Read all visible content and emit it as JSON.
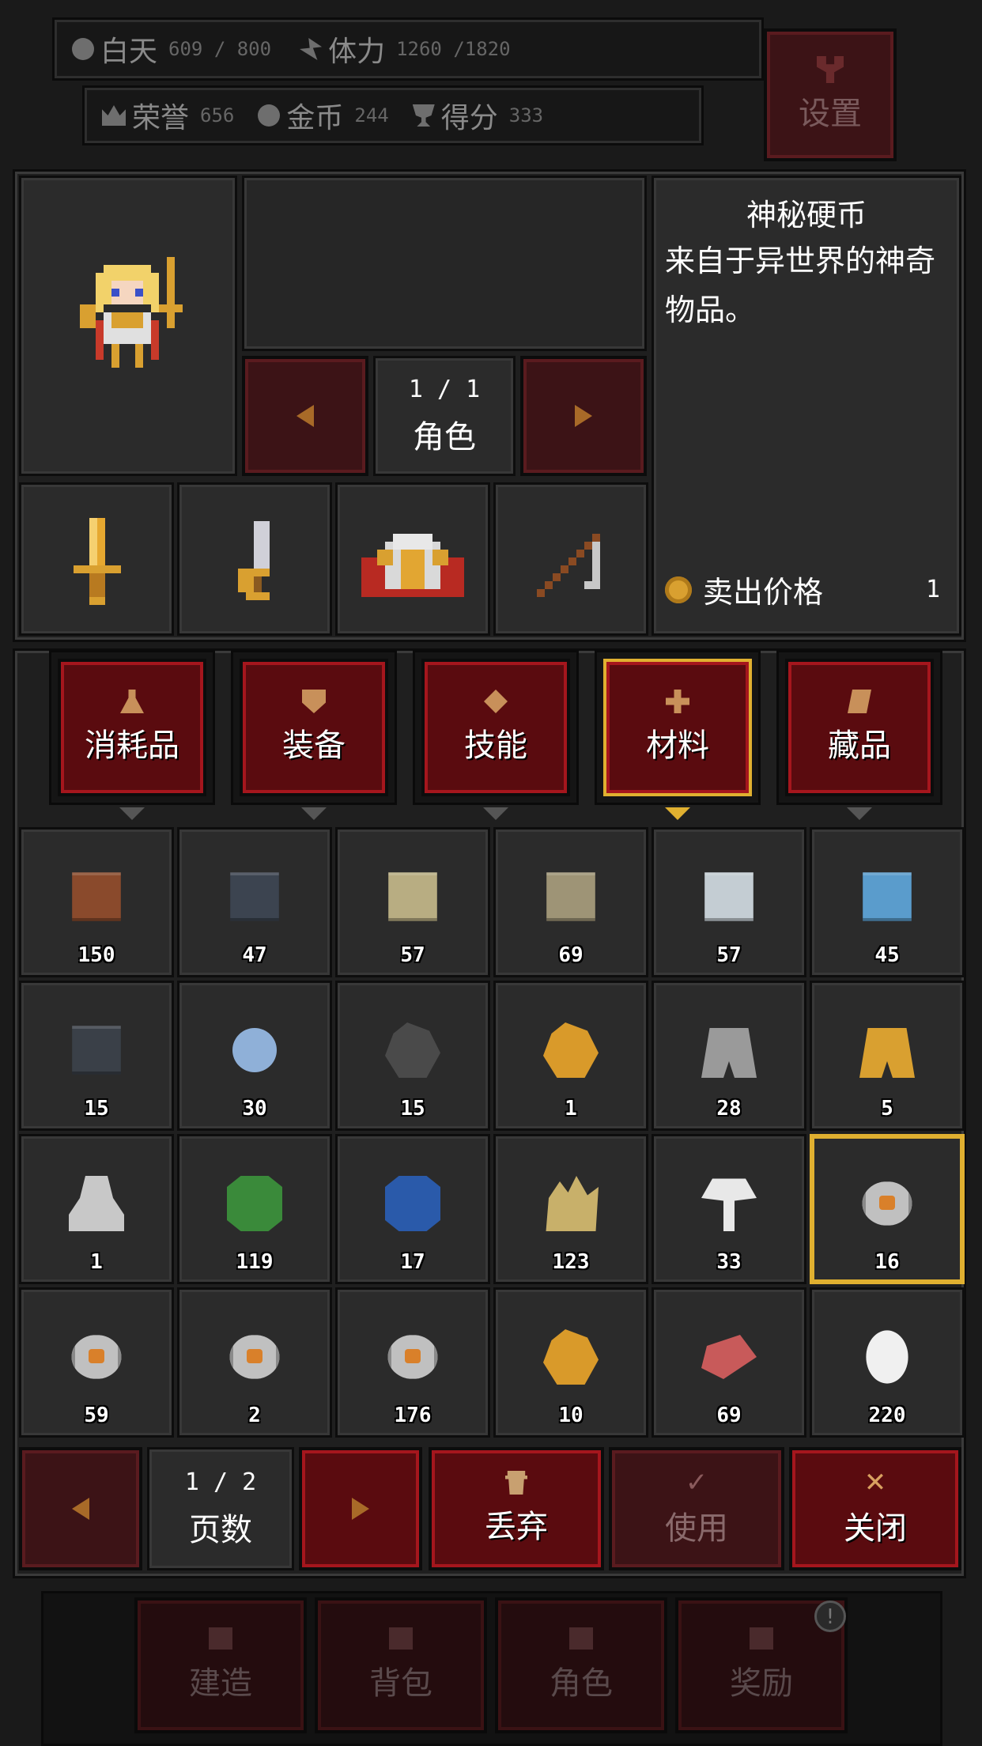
{
  "status": {
    "daytime_label": "白天",
    "daytime_value": "609 / 800",
    "stamina_label": "体力",
    "stamina_value": "1260 /1820",
    "honor_label": "荣誉",
    "honor_value": "656",
    "gold_label": "金币",
    "gold_value": "244",
    "score_label": "得分",
    "score_value": "333",
    "settings_label": "设置"
  },
  "character": {
    "page": "1 / 1",
    "label": "角色",
    "equipment": [
      "sword-icon",
      "dagger-icon",
      "armor-icon",
      "staff-icon"
    ]
  },
  "detail": {
    "name": "神秘硬币",
    "description": "来自于异世界的神奇物品。",
    "sell_label": "卖出价格",
    "sell_value": "1"
  },
  "tabs": [
    {
      "label": "消耗品",
      "icon": "potion-icon",
      "selected": false
    },
    {
      "label": "装备",
      "icon": "shield-icon",
      "selected": false
    },
    {
      "label": "技能",
      "icon": "diamond-icon",
      "selected": false
    },
    {
      "label": "材料",
      "icon": "cross-icon",
      "selected": true
    },
    {
      "label": "藏品",
      "icon": "scroll-icon",
      "selected": false
    }
  ],
  "items": [
    {
      "icon": "brick-icon",
      "count": "150",
      "color": "#8a4a2c"
    },
    {
      "icon": "dark-stone-icon",
      "count": "47",
      "color": "#3c4450"
    },
    {
      "icon": "sandstone-icon",
      "count": "57",
      "color": "#b8ad82"
    },
    {
      "icon": "mossy-stone-icon",
      "count": "69",
      "color": "#9e9476"
    },
    {
      "icon": "marble-icon",
      "count": "57",
      "color": "#c4cdd3"
    },
    {
      "icon": "ice-block-icon",
      "count": "45",
      "color": "#5a9ccc"
    },
    {
      "icon": "stone-wall-icon",
      "count": "15",
      "color": "#3a4048"
    },
    {
      "icon": "gear-orb-icon",
      "count": "30",
      "color": "#8fb0d8"
    },
    {
      "icon": "coal-icon",
      "count": "15",
      "color": "#4a4a4a"
    },
    {
      "icon": "gold-ore-icon",
      "count": "1",
      "color": "#d99a2a"
    },
    {
      "icon": "iron-ingot-icon",
      "count": "28",
      "color": "#9a9a9a"
    },
    {
      "icon": "gold-ingot-icon",
      "count": "5",
      "color": "#d9a030"
    },
    {
      "icon": "silver-statue-icon",
      "count": "1",
      "color": "#c8c8c8"
    },
    {
      "icon": "emerald-icon",
      "count": "119",
      "color": "#3a8a3a"
    },
    {
      "icon": "sapphire-icon",
      "count": "17",
      "color": "#2a5aaa"
    },
    {
      "icon": "crystal-cluster-icon",
      "count": "123",
      "color": "#c8b06a"
    },
    {
      "icon": "mushroom-icon",
      "count": "33",
      "color": "#e8e8e8"
    },
    {
      "icon": "coin-icon",
      "count": "16",
      "color": "#c0c0c0",
      "selected": true
    },
    {
      "icon": "coin-icon",
      "count": "59",
      "color": "#c0c0c0"
    },
    {
      "icon": "coin-icon",
      "count": "2",
      "color": "#c0c0c0"
    },
    {
      "icon": "coin-icon",
      "count": "176",
      "color": "#c0c0c0"
    },
    {
      "icon": "amber-icon",
      "count": "10",
      "color": "#d99a2a"
    },
    {
      "icon": "meat-icon",
      "count": "69",
      "color": "#c85a5a"
    },
    {
      "icon": "egg-icon",
      "count": "220",
      "color": "#f0f0f0"
    }
  ],
  "pager": {
    "page": "1 / 2",
    "label": "页数"
  },
  "actions": {
    "discard": "丢弃",
    "use": "使用",
    "close": "关闭"
  },
  "bottom_nav": [
    "建造",
    "背包",
    "角色",
    "奖励"
  ],
  "colors": {
    "accent_red": "#a5161d",
    "selected_gold": "#e0b030",
    "coin_gold": "#d9a030"
  }
}
